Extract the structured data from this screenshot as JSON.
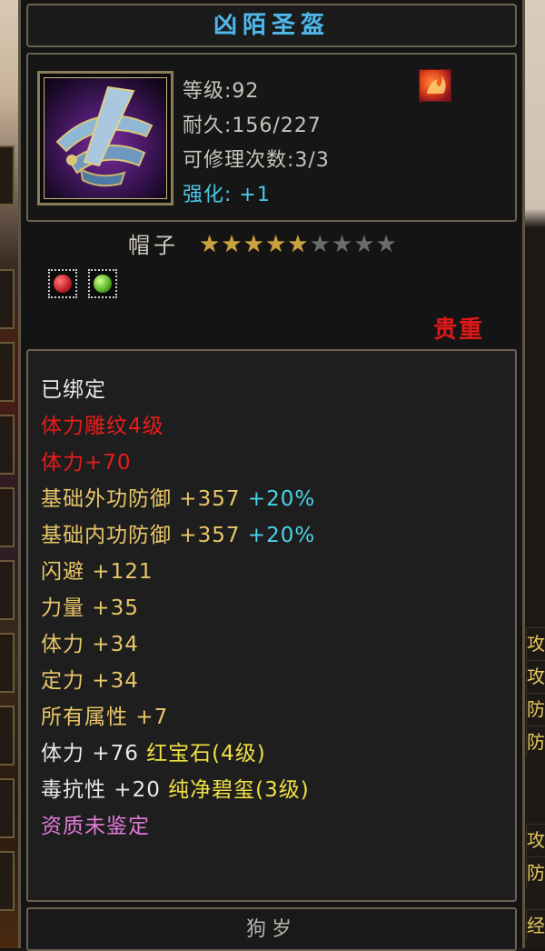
{
  "item": {
    "name": "凶陌圣盔",
    "level": "等级:92",
    "durability": "耐久:156/227",
    "repair": "可修理次数:3/3",
    "enhance": "强化: +1",
    "type": "帽子",
    "stars_total": 9,
    "stars_filled": 5,
    "rarity": "贵重"
  },
  "attributes": [
    {
      "segments": [
        {
          "text": "已绑定",
          "color": "white"
        }
      ]
    },
    {
      "segments": [
        {
          "text": "体力雕纹4级",
          "color": "red"
        }
      ]
    },
    {
      "segments": [
        {
          "text": "体力+70",
          "color": "red"
        }
      ]
    },
    {
      "segments": [
        {
          "text": "基础外功防御 +357 ",
          "color": "gold"
        },
        {
          "text": "+20%",
          "color": "cyan"
        }
      ]
    },
    {
      "segments": [
        {
          "text": "基础内功防御 +357 ",
          "color": "gold"
        },
        {
          "text": "+20%",
          "color": "cyan"
        }
      ]
    },
    {
      "segments": [
        {
          "text": "闪避 +121",
          "color": "gold"
        }
      ]
    },
    {
      "segments": [
        {
          "text": "力量 +35",
          "color": "gold"
        }
      ]
    },
    {
      "segments": [
        {
          "text": "体力 +34",
          "color": "gold"
        }
      ]
    },
    {
      "segments": [
        {
          "text": "定力 +34",
          "color": "gold"
        }
      ]
    },
    {
      "segments": [
        {
          "text": "所有属性 +7",
          "color": "gold"
        }
      ]
    },
    {
      "segments": [
        {
          "text": "体力 +76 ",
          "color": "white"
        },
        {
          "text": "红宝石(4级)",
          "color": "yellow"
        }
      ]
    },
    {
      "segments": [
        {
          "text": "毒抗性 +20 ",
          "color": "white"
        },
        {
          "text": "纯净碧玺(3级)",
          "color": "yellow"
        }
      ]
    },
    {
      "segments": [
        {
          "text": "资质未鉴定",
          "color": "pink"
        }
      ]
    }
  ],
  "footer": "狗岁",
  "right_edge_glyphs": [
    "攻",
    "攻",
    "防",
    "防",
    "攻",
    "防",
    "经"
  ],
  "colors": {
    "title": "#52b8e8",
    "rarity": "#e01818",
    "gem_red": "#c8242c",
    "gem_green": "#5ab82a"
  }
}
